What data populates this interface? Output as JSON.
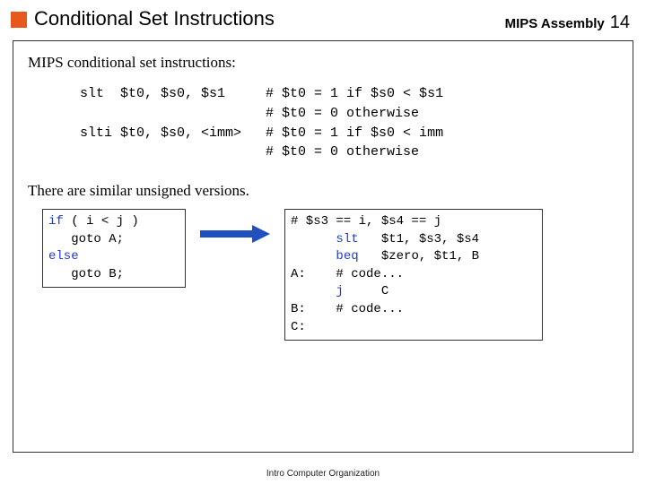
{
  "header": {
    "title": "Conditional Set Instructions",
    "right_label": "MIPS Assembly",
    "page_num": "14"
  },
  "subhead": "MIPS conditional set instructions:",
  "code_main": "slt  $t0, $s0, $s1     # $t0 = 1 if $s0 < $s1\n                       # $t0 = 0 otherwise\nslti $t0, $s0, <imm>   # $t0 = 1 if $s0 < imm\n                       # $t0 = 0 otherwise",
  "note": "There are similar unsigned versions.",
  "code_src": {
    "l1a": "if",
    "l1b": " ( i < j )",
    "l2": "   goto A;",
    "l3a": "else",
    "l4": "   goto B;"
  },
  "code_asm": {
    "l1": "# $s3 == i, $s4 == j",
    "l2a": "slt",
    "l2b": "   $t1, $s3, $s4",
    "l3a": "beq",
    "l3b": "   $zero, $t1, B",
    "l4": "A:    # code...",
    "l5a": "j",
    "l5b": "     C",
    "l6": "B:    # code...",
    "l7": "C:"
  },
  "footer": "Intro Computer Organization"
}
